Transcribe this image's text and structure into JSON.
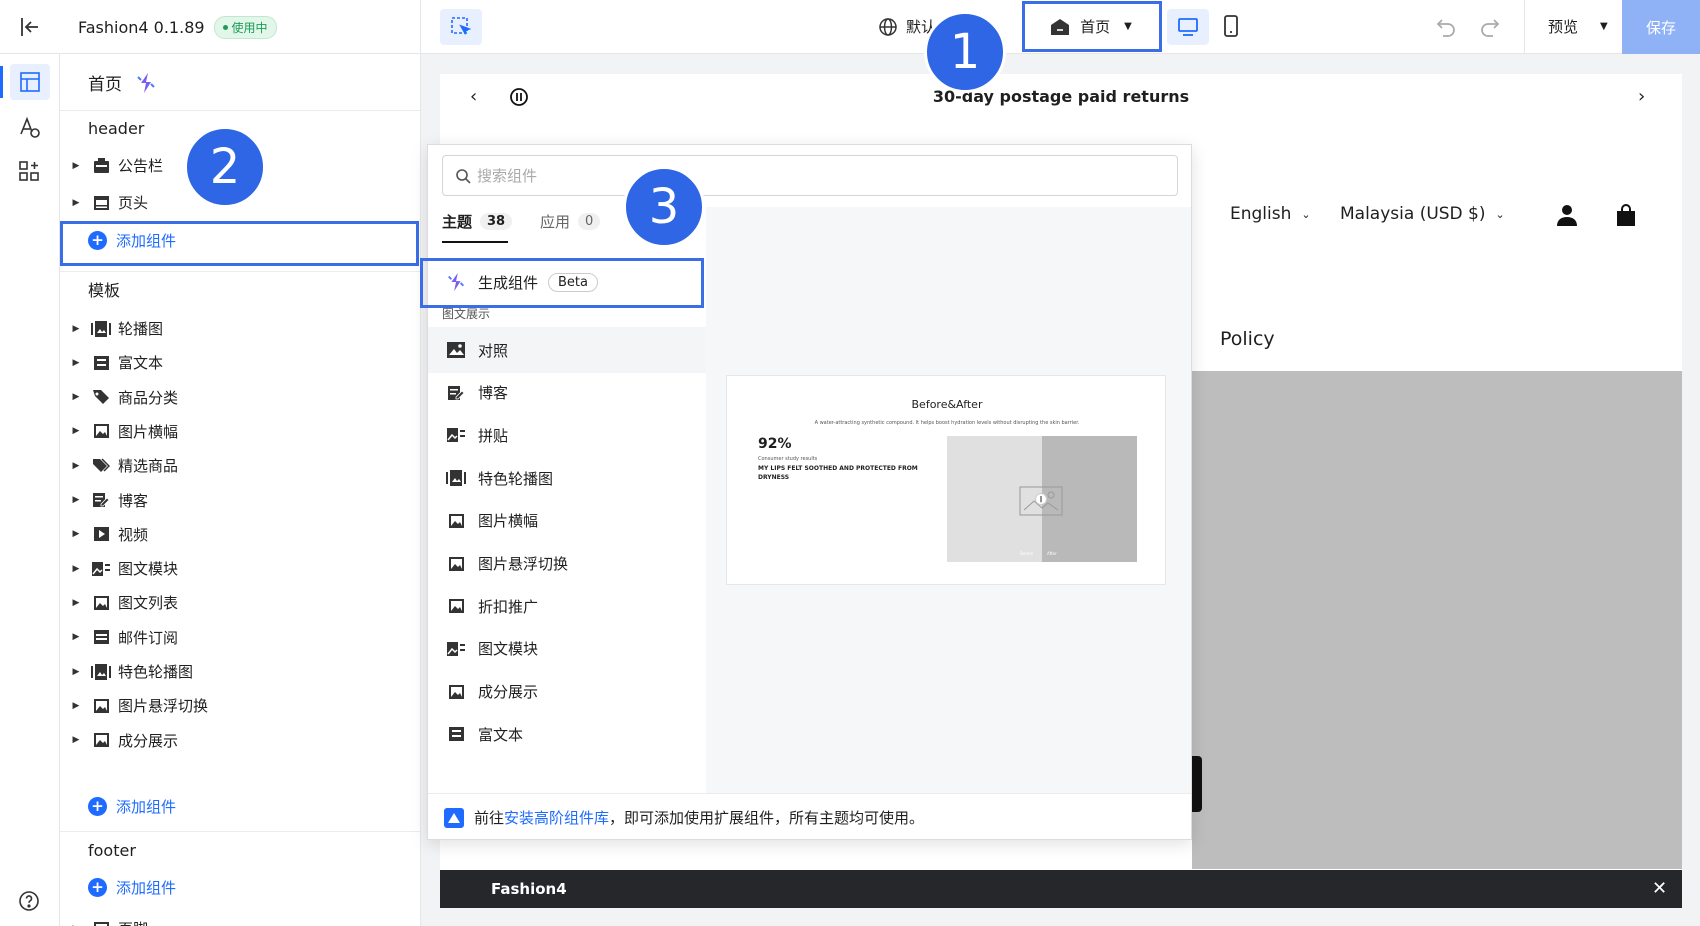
{
  "topbar": {
    "app_name": "Fashion4 0.1.89",
    "status_badge": "使用中",
    "language_label": "默认",
    "page_select": "首页",
    "preview_label": "预览",
    "save_label": "保存"
  },
  "sidebar": {
    "page_title": "首页",
    "header_section": "header",
    "header_items": [
      "公告栏",
      "页头"
    ],
    "add_component": "添加组件",
    "template_section": "模板",
    "template_items": [
      "轮播图",
      "富文本",
      "商品分类",
      "图片横幅",
      "精选商品",
      "博客",
      "视频",
      "图文模块",
      "图文列表",
      "邮件订阅",
      "特色轮播图",
      "图片悬浮切换",
      "成分展示"
    ],
    "footer_section": "footer",
    "footer_item_partial": "页脚"
  },
  "preview": {
    "announcement": "30-day postage paid returns",
    "language": "English",
    "currency": "Malaysia (USD $)",
    "nav_text": "Policy",
    "bottom_bar_title": "Fashion4"
  },
  "popup": {
    "search_placeholder": "搜索组件",
    "tabs": [
      {
        "label": "主题",
        "count": "38"
      },
      {
        "label": "应用",
        "count": "0"
      }
    ],
    "generate_label": "生成组件",
    "beta_badge": "Beta",
    "group_label": "图文展示",
    "items": [
      "对照",
      "博客",
      "拼贴",
      "特色轮播图",
      "图片横幅",
      "图片悬浮切换",
      "折扣推广",
      "图文模块",
      "成分展示",
      "富文本"
    ],
    "footer_prefix": "前往",
    "footer_link": "安装高阶组件库",
    "footer_suffix": "，即可添加使用扩展组件，所有主题均可使用。",
    "preview_card": {
      "title": "Before&After",
      "subtitle": "A water-attracting synthetic compound. It helps boost hydration levels without disrupting the skin barrier.",
      "percent": "92%",
      "stat_caption": "Consumer study results",
      "stat_text": "MY LIPS FELT SOOTHED AND PROTECTED FROM DRYNESS",
      "before_label": "Before",
      "after_label": "After"
    }
  },
  "annotations": [
    "1",
    "2",
    "3"
  ],
  "colors": {
    "accent": "#1f6bff",
    "highlight": "#3a6de6",
    "badge_bg": "#2f66e5",
    "save_bg": "#8fb1f5",
    "status_green": "#1a9e55"
  }
}
